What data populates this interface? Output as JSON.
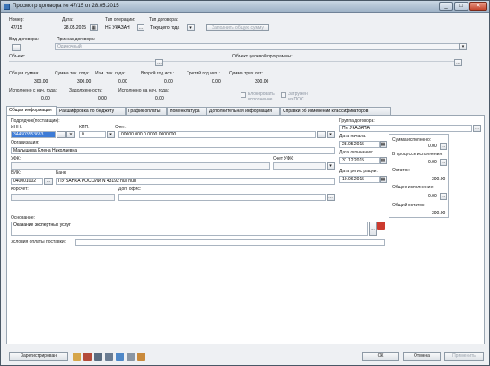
{
  "window": {
    "title": "Просмотр договора № 47/15 от 28.05.2015"
  },
  "header": {
    "number_label": "Номер:",
    "number": "47/15",
    "date_label": "Дата:",
    "date": "28.05.2015",
    "op_type_label": "Тип операции:",
    "op_type": "НЕ УКАЗАН",
    "contract_type_label": "Тип договора:",
    "contract_type": "Текущего года",
    "fill_amount_button": "Заполнить общую сумму",
    "contract_kind_label": "Вид договора:",
    "contract_kind": "...",
    "sign_label": "Признак договора:",
    "sign": "Одиночный",
    "object_label": "Объект:",
    "target_object_label": "Объект целевой программы:",
    "total_label": "Общая сумма:",
    "total": "300.00",
    "cur_year_label": "Сумма тек. года:",
    "cur_year": "300.00",
    "chg_cur_year_label": "Изм. тек. года:",
    "chg_cur_year": "0.00",
    "second_year_label": "Второй год исп.:",
    "second_year": "0.00",
    "third_year_label": "Третий год исп.:",
    "third_year": "0.00",
    "three_years_label": "Сумма трех лет:",
    "three_years": "300.00",
    "exec_from_start_label": "Исполнено с нач. года:",
    "exec_from_start": "0.00",
    "debt_label": "Задолженность:",
    "debt": "0.00",
    "exec_to_start_label": "Исполнено на нач. года:",
    "exec_to_start": "0.00",
    "blocked_label": "Блокировать исполнение",
    "loaded_label": "Загружен из ПОС"
  },
  "tabs": [
    "Общая информация",
    "Расшифровка по бюджету",
    "График оплаты",
    "Номенклатура",
    "Дополнительная информация",
    "Справки об изменении классификаторов"
  ],
  "general": {
    "contractor_label": "Подрядчик(поставщик):",
    "inn_label": "ИНН:",
    "inn": "344503553633",
    "kpp_label": "КПП:",
    "kpp": "0",
    "account_label": "Счет:",
    "account": "00000.000.0.0000.0000000",
    "org_label": "Организация:",
    "org": "Малышева Елена Николаевна",
    "ufk_label": "УФК:",
    "ufk_account_label": "Счет УФК:",
    "bik_label": "БИК:",
    "bik": "040001002",
    "bank_label": "Банк:",
    "bank": "ПУ БАНКА РОССИИ N 43192 null null",
    "corr_label": "Корсчет:",
    "office_label": "Доп. офис:",
    "basis_label": "Основание:",
    "basis": "Оказание экспертных услуг",
    "delivery_label": "Условия оплаты поставки:"
  },
  "right": {
    "group_label": "Группа договора:",
    "group": "НЕ УКАЗАНА",
    "start_label": "Дата начала:",
    "start": "28.05.2015",
    "end_label": "Дата окончания:",
    "end": "31.12.2015",
    "reg_label": "Дата регистрации:",
    "reg": "10.06.2015",
    "sum_exec_label": "Сумма исполнено:",
    "sum_exec": "0.00",
    "in_process_label": "В процессе исполнения:",
    "in_process": "0.00",
    "rest_label": "Остаток:",
    "rest": "300.00",
    "total_exec_label": "Общее исполнение:",
    "total_exec": "0.00",
    "total_rest_label": "Общий остаток:",
    "total_rest": "300.00"
  },
  "footer": {
    "registered": "Зарегистрирован",
    "ok": "ОК",
    "cancel": "Отмена",
    "apply": "Применить"
  }
}
